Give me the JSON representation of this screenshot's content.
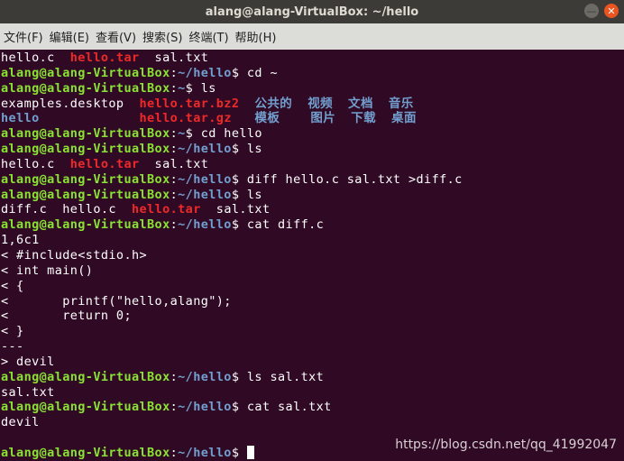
{
  "window": {
    "title": "alang@alang-VirtualBox: ~/hello",
    "minimize_glyph": "—",
    "close_glyph": "✕"
  },
  "menu": [
    "文件(F)",
    "编辑(E)",
    "查看(V)",
    "搜索(S)",
    "终端(T)",
    "帮助(H)"
  ],
  "colors": {
    "prompt_user": "#8ae234",
    "prompt_path": "#729fcf",
    "archive": "#ef2929",
    "background": "#300a24"
  },
  "terminal_lines": [
    [
      [
        "w",
        "hello.c  "
      ],
      [
        "r",
        "hello.tar"
      ],
      [
        "w",
        "  sal.txt"
      ]
    ],
    [
      [
        "g",
        "alang@alang-VirtualBox"
      ],
      [
        "w",
        ":"
      ],
      [
        "b",
        "~/hello"
      ],
      [
        "w",
        "$ cd ~"
      ]
    ],
    [
      [
        "g",
        "alang@alang-VirtualBox"
      ],
      [
        "w",
        ":"
      ],
      [
        "b",
        "~"
      ],
      [
        "w",
        "$ ls"
      ]
    ],
    [
      [
        "w",
        "examples.desktop  "
      ],
      [
        "r",
        "hello.tar.bz2"
      ],
      [
        "w",
        "  "
      ],
      [
        "b",
        "公共的  视频  文档  音乐"
      ]
    ],
    [
      [
        "b",
        "hello"
      ],
      [
        "w",
        "             "
      ],
      [
        "r",
        "hello.tar.gz"
      ],
      [
        "w",
        "   "
      ],
      [
        "b",
        "模板    图片  下载  桌面"
      ]
    ],
    [
      [
        "g",
        "alang@alang-VirtualBox"
      ],
      [
        "w",
        ":"
      ],
      [
        "b",
        "~"
      ],
      [
        "w",
        "$ cd hello"
      ]
    ],
    [
      [
        "g",
        "alang@alang-VirtualBox"
      ],
      [
        "w",
        ":"
      ],
      [
        "b",
        "~/hello"
      ],
      [
        "w",
        "$ ls"
      ]
    ],
    [
      [
        "w",
        "hello.c  "
      ],
      [
        "r",
        "hello.tar"
      ],
      [
        "w",
        "  sal.txt"
      ]
    ],
    [
      [
        "g",
        "alang@alang-VirtualBox"
      ],
      [
        "w",
        ":"
      ],
      [
        "b",
        "~/hello"
      ],
      [
        "w",
        "$ diff hello.c sal.txt >diff.c"
      ]
    ],
    [
      [
        "g",
        "alang@alang-VirtualBox"
      ],
      [
        "w",
        ":"
      ],
      [
        "b",
        "~/hello"
      ],
      [
        "w",
        "$ ls"
      ]
    ],
    [
      [
        "w",
        "diff.c  hello.c  "
      ],
      [
        "r",
        "hello.tar"
      ],
      [
        "w",
        "  sal.txt"
      ]
    ],
    [
      [
        "g",
        "alang@alang-VirtualBox"
      ],
      [
        "w",
        ":"
      ],
      [
        "b",
        "~/hello"
      ],
      [
        "w",
        "$ cat diff.c"
      ]
    ],
    [
      [
        "w",
        "1,6c1"
      ]
    ],
    [
      [
        "w",
        "< #include<stdio.h>"
      ]
    ],
    [
      [
        "w",
        "< int main()"
      ]
    ],
    [
      [
        "w",
        "< {"
      ]
    ],
    [
      [
        "w",
        "<       printf(\"hello,alang\");"
      ]
    ],
    [
      [
        "w",
        "<       return 0;"
      ]
    ],
    [
      [
        "w",
        "< }"
      ]
    ],
    [
      [
        "w",
        "---"
      ]
    ],
    [
      [
        "w",
        "> devil"
      ]
    ],
    [
      [
        "g",
        "alang@alang-VirtualBox"
      ],
      [
        "w",
        ":"
      ],
      [
        "b",
        "~/hello"
      ],
      [
        "w",
        "$ ls sal.txt"
      ]
    ],
    [
      [
        "w",
        "sal.txt"
      ]
    ],
    [
      [
        "g",
        "alang@alang-VirtualBox"
      ],
      [
        "w",
        ":"
      ],
      [
        "b",
        "~/hello"
      ],
      [
        "w",
        "$ cat sal.txt"
      ]
    ],
    [
      [
        "w",
        "devil"
      ]
    ],
    [
      [
        "w",
        ""
      ]
    ],
    [
      [
        "g",
        "alang@alang-VirtualBox"
      ],
      [
        "w",
        ":"
      ],
      [
        "b",
        "~/hello"
      ],
      [
        "w",
        "$ "
      ]
    ]
  ],
  "watermark": "https://blog.csdn.net/qq_41992047"
}
